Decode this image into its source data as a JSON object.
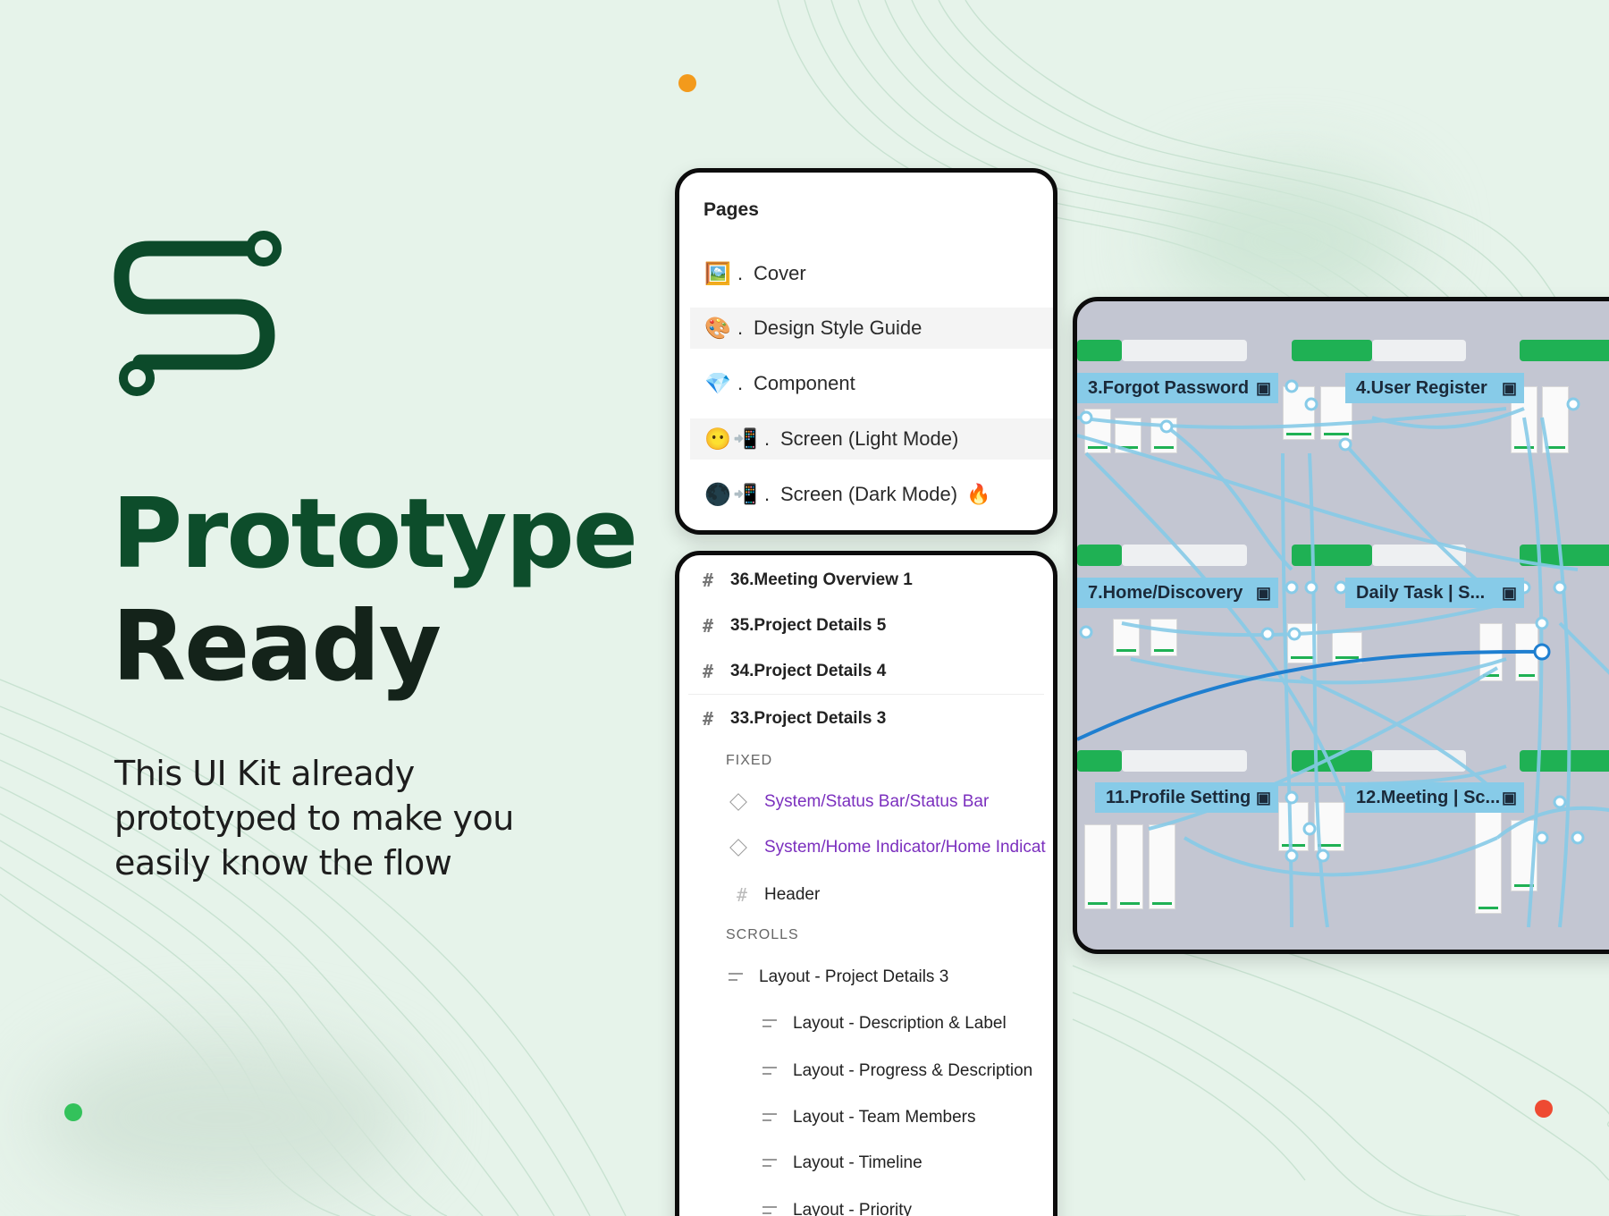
{
  "headline": {
    "line1": "Prototype",
    "line2": "Ready"
  },
  "subtext": "This UI Kit already prototyped to make you easily know the flow",
  "colors": {
    "background": "#e6f3ea",
    "brand_green": "#0d4d2b",
    "accent_orange": "#f39a1c",
    "accent_red": "#ee4a32",
    "accent_green": "#33c25b",
    "flow_blue": "#87cbe8"
  },
  "pages_panel": {
    "title": "Pages",
    "items": [
      {
        "icon": "🖼️",
        "sep": ".",
        "label": "Cover"
      },
      {
        "icon": "🎨",
        "sep": ".",
        "label": "Design Style Guide"
      },
      {
        "icon": "💎",
        "sep": ".",
        "label": "Component"
      },
      {
        "icon": "😶",
        "icon2": "📲",
        "sep": ".",
        "label": "Screen (Light Mode)"
      },
      {
        "icon": "🌑",
        "icon2": "📲",
        "sep": ".",
        "label": "Screen (Dark Mode)",
        "tail": "🔥"
      }
    ]
  },
  "layers_panel": {
    "frames": [
      "36.Meeting Overview 1",
      "35.Project Details 5",
      "34.Project Details 4",
      "33.Project Details 3"
    ],
    "fixed_label": "FIXED",
    "fixed_items": [
      "System/Status Bar/Status Bar",
      "System/Home Indicator/Home Indicat"
    ],
    "header": "Header",
    "scrolls_label": "SCROLLS",
    "layout_parent": "Layout - Project Details 3",
    "layout_children": [
      "Layout - Description & Label",
      "Layout - Progress & Description",
      "Layout - Team Members",
      "Layout - Timeline",
      "Layout - Priority"
    ]
  },
  "prototype_canvas": {
    "flows": [
      "3.Forgot Password",
      "4.User Register",
      "7.Home/Discovery",
      "Daily Task | S...",
      "11.Profile Setting",
      "12.Meeting | Sc..."
    ]
  }
}
